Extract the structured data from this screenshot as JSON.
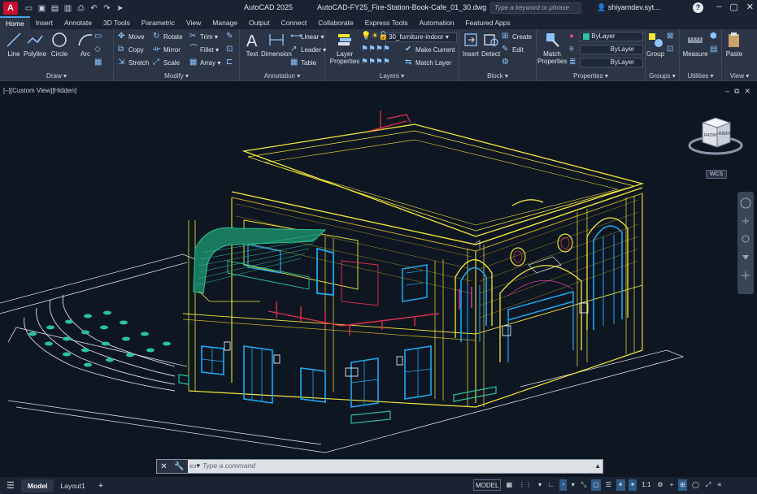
{
  "title": {
    "app": "AutoCAD 2025",
    "file": "AutoCAD-FY25_Fire-Station-Book-Cafe_01_30.dwg",
    "search_placeholder": "Type a keyword or phrase",
    "user": "shiyamdev.syt..."
  },
  "tabs": [
    "Home",
    "Insert",
    "Annotate",
    "3D Tools",
    "Parametric",
    "View",
    "Manage",
    "Output",
    "Connect",
    "Collaborate",
    "Express Tools",
    "Automation",
    "Featured Apps"
  ],
  "ribbon": {
    "draw": {
      "title": "Draw ▾",
      "line": "Line",
      "polyline": "Polyline",
      "circle": "Circle",
      "arc": "Arc"
    },
    "modify": {
      "title": "Modify ▾",
      "move": "Move",
      "rotate": "Rotate",
      "trim": "Trim ▾",
      "copy": "Copy",
      "mirror": "Mirror",
      "fillet": "Fillet ▾",
      "stretch": "Stretch",
      "scale": "Scale",
      "array": "Array ▾"
    },
    "annotation": {
      "title": "Annotation ▾",
      "text": "Text",
      "dimension": "Dimension",
      "linear": "Linear ▾",
      "leader": "Leader ▾",
      "table": "Table"
    },
    "layers": {
      "title": "Layers ▾",
      "layer_properties": "Layer Properties",
      "current_layer": "30_furniture-indoor",
      "make_current": "Make Current",
      "match_layer": "Match Layer"
    },
    "block": {
      "title": "Block ▾",
      "insert": "Insert",
      "detect": "Detect",
      "create": "Create",
      "edit": "Edit"
    },
    "properties": {
      "title": "Properties ▾",
      "match_properties": "Match Properties",
      "color": "ByLayer",
      "linetype": "ByLayer",
      "lineweight": "ByLayer"
    },
    "groups": {
      "title": "Groups ▾",
      "group": "Group"
    },
    "utilities": {
      "title": "Utilities ▾",
      "measure": "Measure"
    },
    "view": {
      "title": "View ▾",
      "paste": "Paste"
    }
  },
  "viewport": {
    "label": "[–][Custom View][Hidden]",
    "viewcube_front": "FRONT",
    "viewcube_right": "RIGHT",
    "wcs": "WCS"
  },
  "command": {
    "placeholder": "Type a command"
  },
  "status": {
    "layout_tabs": [
      "Model",
      "Layout1"
    ],
    "model": "MODEL",
    "scale": "1:1"
  },
  "colors": {
    "yellow": "#f5e63a",
    "cyan": "#1fa8f0",
    "green": "#2cc29a",
    "red": "#e0304a",
    "magenta": "#e040a0",
    "white": "#d8dde4"
  }
}
